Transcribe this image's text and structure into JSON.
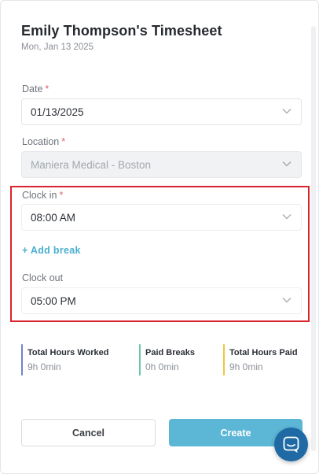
{
  "header": {
    "title": "Emily Thompson's Timesheet",
    "subtitle": "Mon, Jan 13 2025"
  },
  "form": {
    "required_mark": "*",
    "date": {
      "label": "Date",
      "value": "01/13/2025"
    },
    "location": {
      "label": "Location",
      "value": "Maniera Medical - Boston"
    },
    "clock_in": {
      "label": "Clock in",
      "value": "08:00 AM"
    },
    "add_break_label": "+ Add break",
    "clock_out": {
      "label": "Clock out",
      "value": "05:00 PM"
    }
  },
  "summary": [
    {
      "title": "Total Hours Worked",
      "value": "9h 0min",
      "color": "#6f83c9"
    },
    {
      "title": "Paid Breaks",
      "value": "0h 0min",
      "color": "#6cc8a2"
    },
    {
      "title": "Total Hours Paid",
      "value": "9h 0min",
      "color": "#f1c53f"
    }
  ],
  "actions": {
    "cancel_label": "Cancel",
    "create_label": "Create"
  },
  "colors": {
    "highlight": "#d9232d",
    "accent": "#5cb6d6",
    "link": "#4aaed0",
    "required": "#e0626e",
    "chat": "#1f6aa5"
  },
  "icons": {
    "select_chevron": "chevron-down-icon",
    "chat": "chat-icon"
  }
}
